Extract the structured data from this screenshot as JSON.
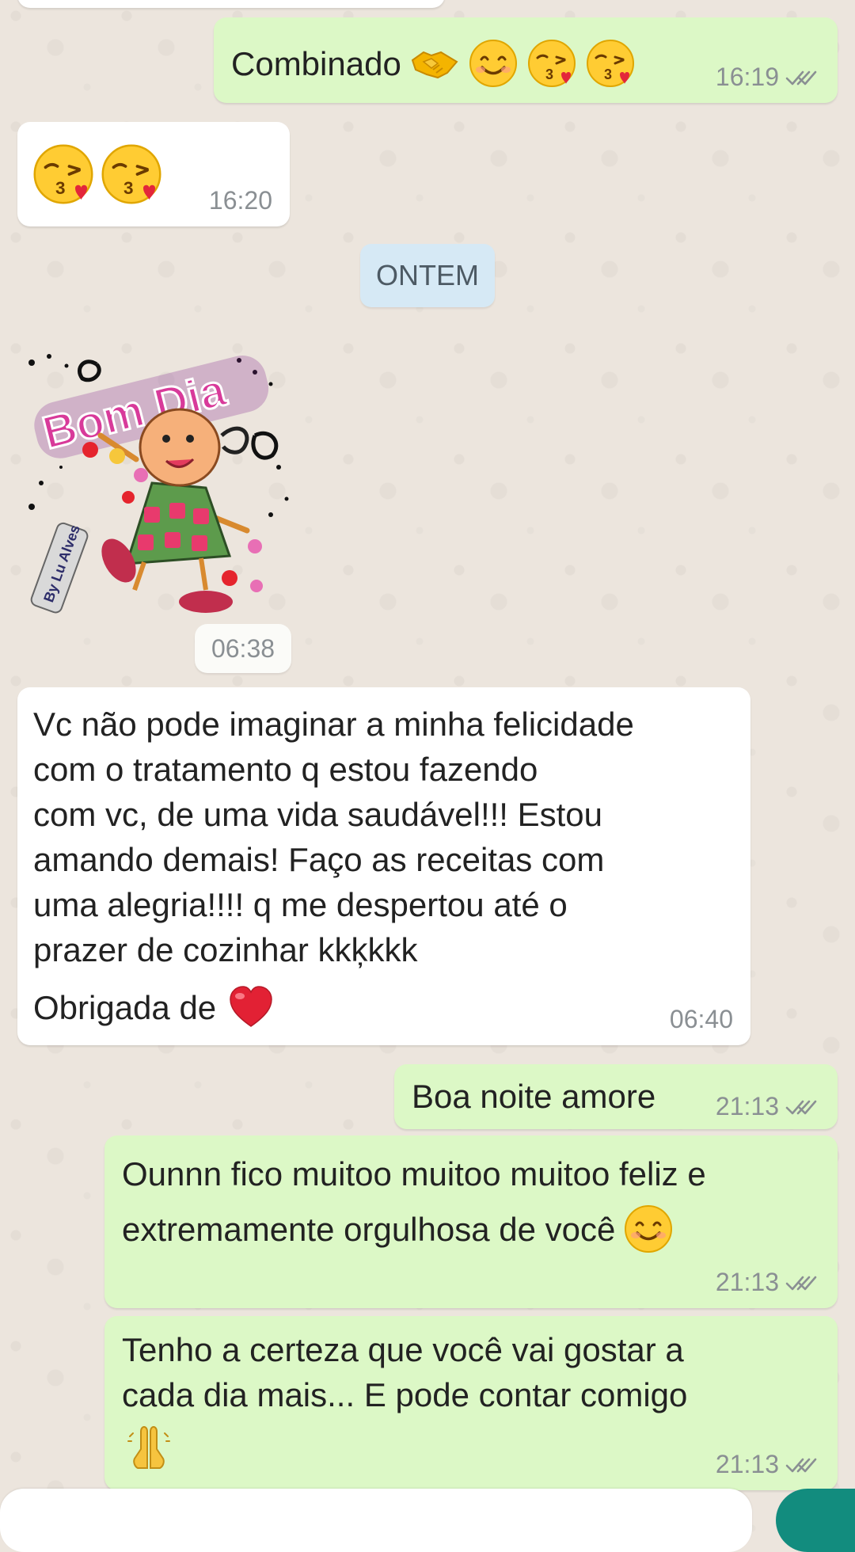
{
  "chat": {
    "date_separator": "ONTEM",
    "messages": [
      {
        "direction": "outgoing",
        "text": "Combinado",
        "time": "16:19"
      },
      {
        "direction": "incoming",
        "time": "16:20"
      },
      {
        "direction": "incoming",
        "sticker_text": "Bom Dia",
        "sticker_signature": "By Lu Alves",
        "time": "06:38"
      },
      {
        "direction": "incoming",
        "text": "Vc não pode imaginar a minha felicidade\ncom o tratamento q estou fazendo\ncom vc, de uma vida saudável!!! Estou\namando demais! Faço as receitas com\numa alegria!!!! q me despertou até o\nprazer de cozinhar kkķkkk",
        "text_line2": "Obrigada de",
        "time": "06:40"
      },
      {
        "direction": "outgoing",
        "text": "Boa noite amore",
        "time": "21:13"
      },
      {
        "direction": "outgoing",
        "text": "Ounnn fico muitoo muitoo muitoo feliz e",
        "text_line2": "extremamente orgulhosa de você",
        "time": "21:13"
      },
      {
        "direction": "outgoing",
        "text": "Tenho a certeza que você vai gostar a\ncada dia mais... E pode contar comigo",
        "time": "21:13"
      }
    ]
  },
  "theme": {
    "outgoing_bubble": "#dcf8c6",
    "incoming_bubble": "#ffffff",
    "date_chip": "#d6e9f5",
    "background": "#ece5dd",
    "tick_color": "#8a8f93"
  },
  "icons": {
    "handshake": "handshake-emoji",
    "smile": "smiling-face-emoji",
    "kiss": "face-blowing-kiss-emoji",
    "heart": "red-heart-emoji",
    "pray": "folded-hands-emoji",
    "read_receipt": "double-check-icon"
  }
}
